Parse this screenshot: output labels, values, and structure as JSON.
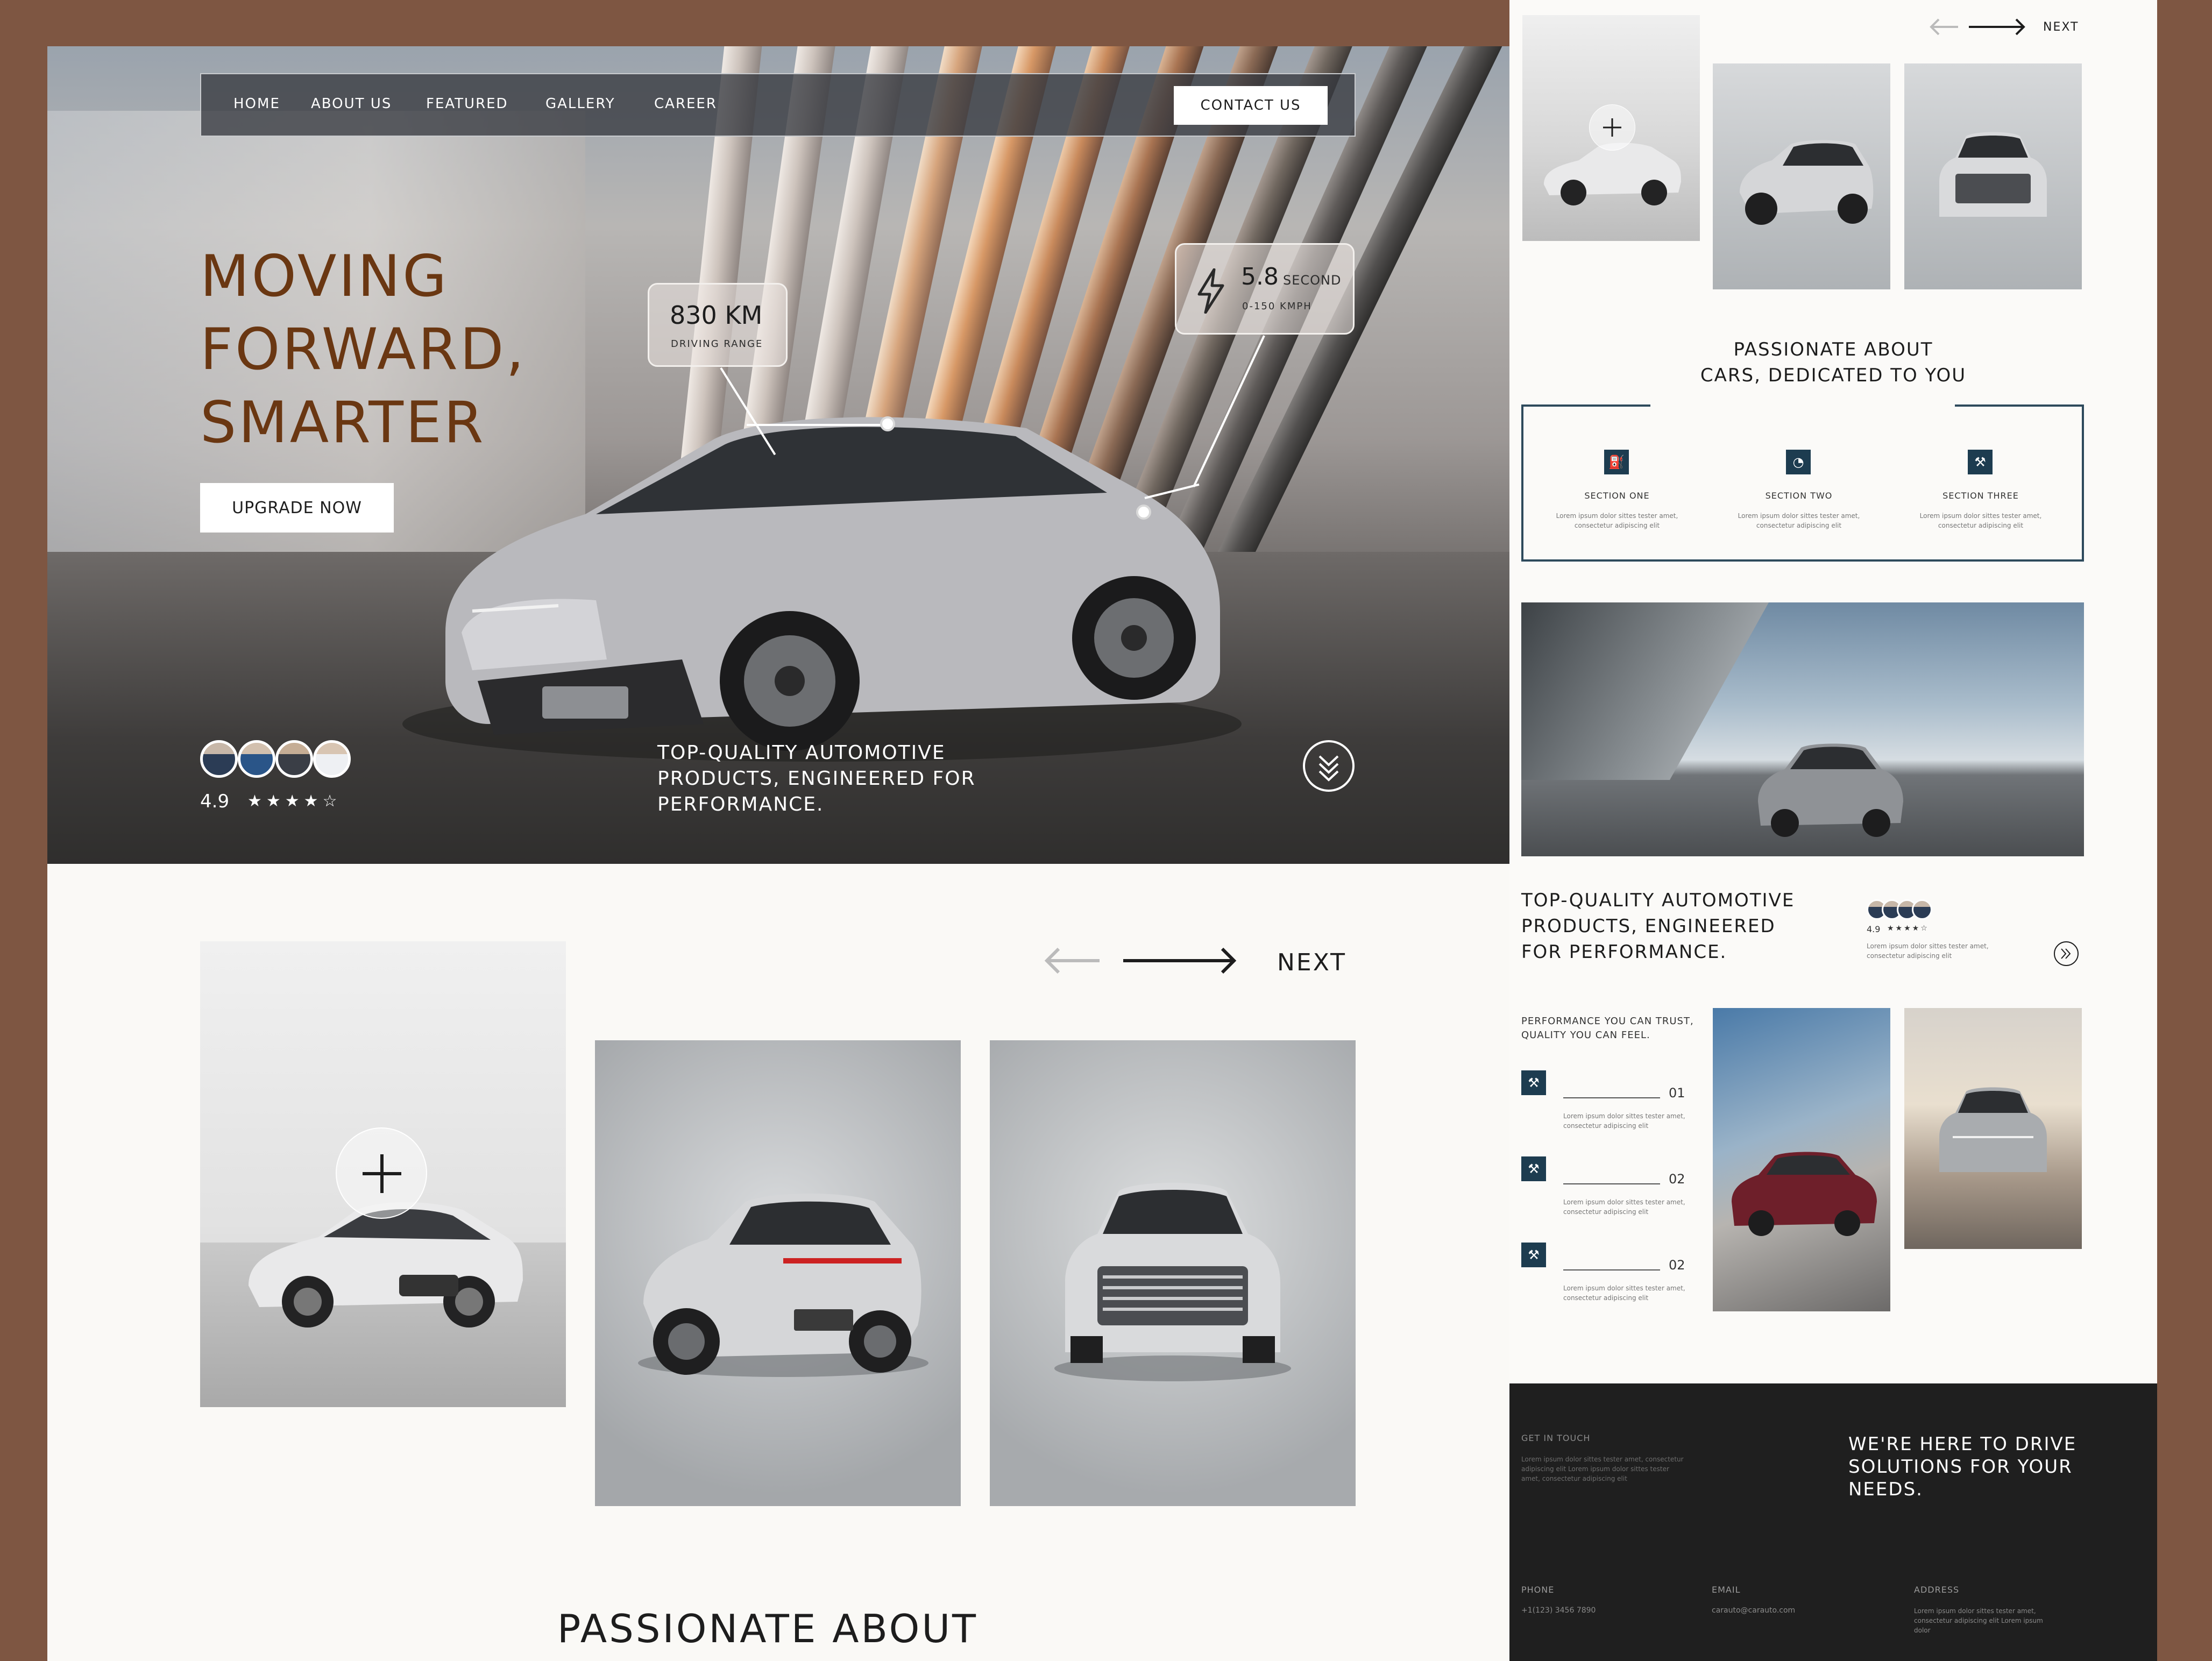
{
  "nav": {
    "items": [
      "HOME",
      "ABOUT US",
      "FEATURED",
      "GALLERY",
      "CAREER"
    ],
    "contact_label": "CONTACT US"
  },
  "hero": {
    "headline": [
      "MOVING",
      "FORWARD,",
      "SMARTER"
    ],
    "cta_label": "UPGRADE NOW",
    "range": {
      "value": "830 KM",
      "label": "DRIVING RANGE"
    },
    "accel": {
      "value": "5.8",
      "unit": "SECOND",
      "label": "0-150 KMPH"
    },
    "rating": {
      "score": "4.9",
      "stars": 4.5
    },
    "tagline": [
      "TOP-QUALITY AUTOMOTIVE",
      "PRODUCTS, ENGINEERED FOR",
      "PERFORMANCE."
    ],
    "scroll_icon": "chevrons-down-icon"
  },
  "gallery": {
    "next_label": "NEXT",
    "bottom_title": "PASSIONATE ABOUT"
  },
  "right": {
    "next_label": "NEXT",
    "passion_title": [
      "PASSIONATE ABOUT",
      "CARS, DEDICATED TO YOU"
    ],
    "sections": [
      {
        "title": "SECTION ONE",
        "icon": "gas-pump-icon",
        "text": [
          "Lorem ipsum dolor sittes tester amet,",
          "consectetur adipiscing elit"
        ]
      },
      {
        "title": "SECTION TWO",
        "icon": "gauge-icon",
        "text": [
          "Lorem ipsum dolor sittes tester amet,",
          "consectetur adipiscing elit"
        ]
      },
      {
        "title": "SECTION THREE",
        "icon": "tools-icon",
        "text": [
          "Lorem ipsum dolor sittes tester amet,",
          "consectetur adipiscing elit"
        ]
      }
    ],
    "tagline": [
      "TOP-QUALITY AUTOMOTIVE",
      "PRODUCTS, ENGINEERED",
      "FOR PERFORMANCE."
    ],
    "rating_score": "4.9",
    "rating_text": [
      "Lorem ipsum dolor sittes tester amet,",
      "consectetur adipiscing elit"
    ],
    "perf_title": [
      "PERFORMANCE YOU CAN TRUST,",
      "QUALITY YOU CAN FEEL."
    ],
    "perf_items": [
      {
        "num": "01",
        "text": [
          "Lorem ipsum dolor sittes tester amet,",
          "consectetur adipiscing elit"
        ]
      },
      {
        "num": "02",
        "text": [
          "Lorem ipsum dolor sittes tester amet,",
          "consectetur adipiscing elit"
        ]
      },
      {
        "num": "02",
        "text": [
          "Lorem ipsum dolor sittes tester amet,",
          "consectetur adipiscing elit"
        ]
      }
    ]
  },
  "footer": {
    "get_in_touch": "GET IN TOUCH",
    "intro": [
      "Lorem ipsum dolor sittes tester amet, consectetur",
      "adipiscing elit Lorem ipsum dolor sittes tester",
      "amet, consectetur adipiscing elit"
    ],
    "slogan": [
      "WE'RE HERE TO DRIVE",
      "SOLUTIONS FOR YOUR",
      "NEEDS."
    ],
    "phone_label": "PHONE",
    "phone": "+1(123) 3456 7890",
    "email_label": "EMAIL",
    "email": "carauto@carauto.com",
    "address_label": "ADDRESS",
    "address": [
      "Lorem ipsum dolor sittes tester amet,",
      "consectetur adipiscing elit Lorem ipsum",
      "dolor"
    ]
  },
  "colors": {
    "frame": "#7e5642",
    "headline": "#6a3712",
    "accent": "#1d3c50",
    "footer": "#1f1f1f"
  }
}
